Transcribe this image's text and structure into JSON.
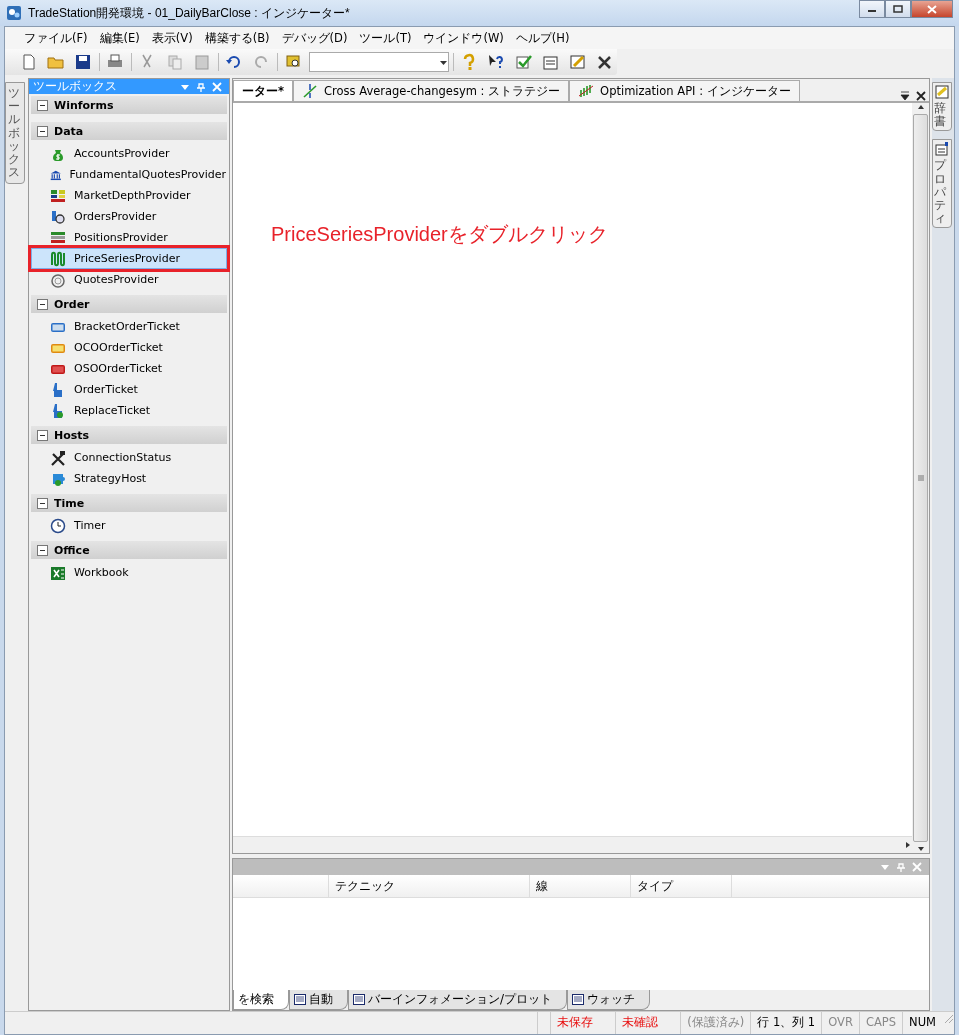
{
  "window": {
    "title": "TradeStation開発環境 - 01_DailyBarClose : インジケーター*"
  },
  "menu": [
    "ファイル(F)",
    "編集(E)",
    "表示(V)",
    "構築する(B)",
    "デバッグ(D)",
    "ツール(T)",
    "ウインドウ(W)",
    "ヘルプ(H)"
  ],
  "left_dock_tab": "ツールボックス",
  "toolbox": {
    "title": "ツールボックス",
    "groups": [
      {
        "label": "Winforms",
        "expanded": true
      },
      {
        "label": "Data",
        "expanded": true,
        "items": [
          {
            "label": "AccountsProvider",
            "selected": false
          },
          {
            "label": "FundamentalQuotesProvider",
            "selected": false
          },
          {
            "label": "MarketDepthProvider",
            "selected": false
          },
          {
            "label": "OrdersProvider",
            "selected": false
          },
          {
            "label": "PositionsProvider",
            "selected": false
          },
          {
            "label": "PriceSeriesProvider",
            "selected": true
          },
          {
            "label": "QuotesProvider",
            "selected": false
          }
        ]
      },
      {
        "label": "Order",
        "expanded": true,
        "items": [
          {
            "label": "BracketOrderTicket",
            "selected": false
          },
          {
            "label": "OCOOrderTicket",
            "selected": false
          },
          {
            "label": "OSOOrderTicket",
            "selected": false
          },
          {
            "label": "OrderTicket",
            "selected": false
          },
          {
            "label": "ReplaceTicket",
            "selected": false
          }
        ]
      },
      {
        "label": "Hosts",
        "expanded": true,
        "items": [
          {
            "label": "ConnectionStatus",
            "selected": false
          },
          {
            "label": "StrategyHost",
            "selected": false
          }
        ]
      },
      {
        "label": "Time",
        "expanded": true,
        "items": [
          {
            "label": "Timer",
            "selected": false
          }
        ]
      },
      {
        "label": "Office",
        "expanded": true,
        "items": [
          {
            "label": "Workbook",
            "selected": false
          }
        ]
      }
    ]
  },
  "editor_tabs": [
    {
      "label": "ーター*",
      "selected": true
    },
    {
      "label": "Cross Average-changesym : ストラテジー",
      "selected": false
    },
    {
      "label": "Optimization API : インジケーター",
      "selected": false
    }
  ],
  "annotation": "PriceSeriesProviderをダブルクリック",
  "bottom_panel": {
    "columns": [
      "テクニック",
      "線",
      "タイプ"
    ],
    "tabs": [
      {
        "label": "を検索",
        "selected": true
      },
      {
        "label": "自動",
        "selected": false
      },
      {
        "label": "バーインフォメーション/プロット",
        "selected": false
      },
      {
        "label": "ウォッチ",
        "selected": false
      }
    ]
  },
  "right_dock_tabs": [
    "辞書",
    "プロパティ"
  ],
  "status_bar": [
    {
      "text": "未保存",
      "kind": "alert"
    },
    {
      "text": "未確認",
      "kind": "alert"
    },
    {
      "text": "(保護済み)",
      "kind": "muted"
    },
    {
      "text": "行 1、列 1",
      "kind": "normal"
    },
    {
      "text": "OVR",
      "kind": "muted"
    },
    {
      "text": "CAPS",
      "kind": "muted"
    },
    {
      "text": "NUM",
      "kind": "normal"
    }
  ]
}
